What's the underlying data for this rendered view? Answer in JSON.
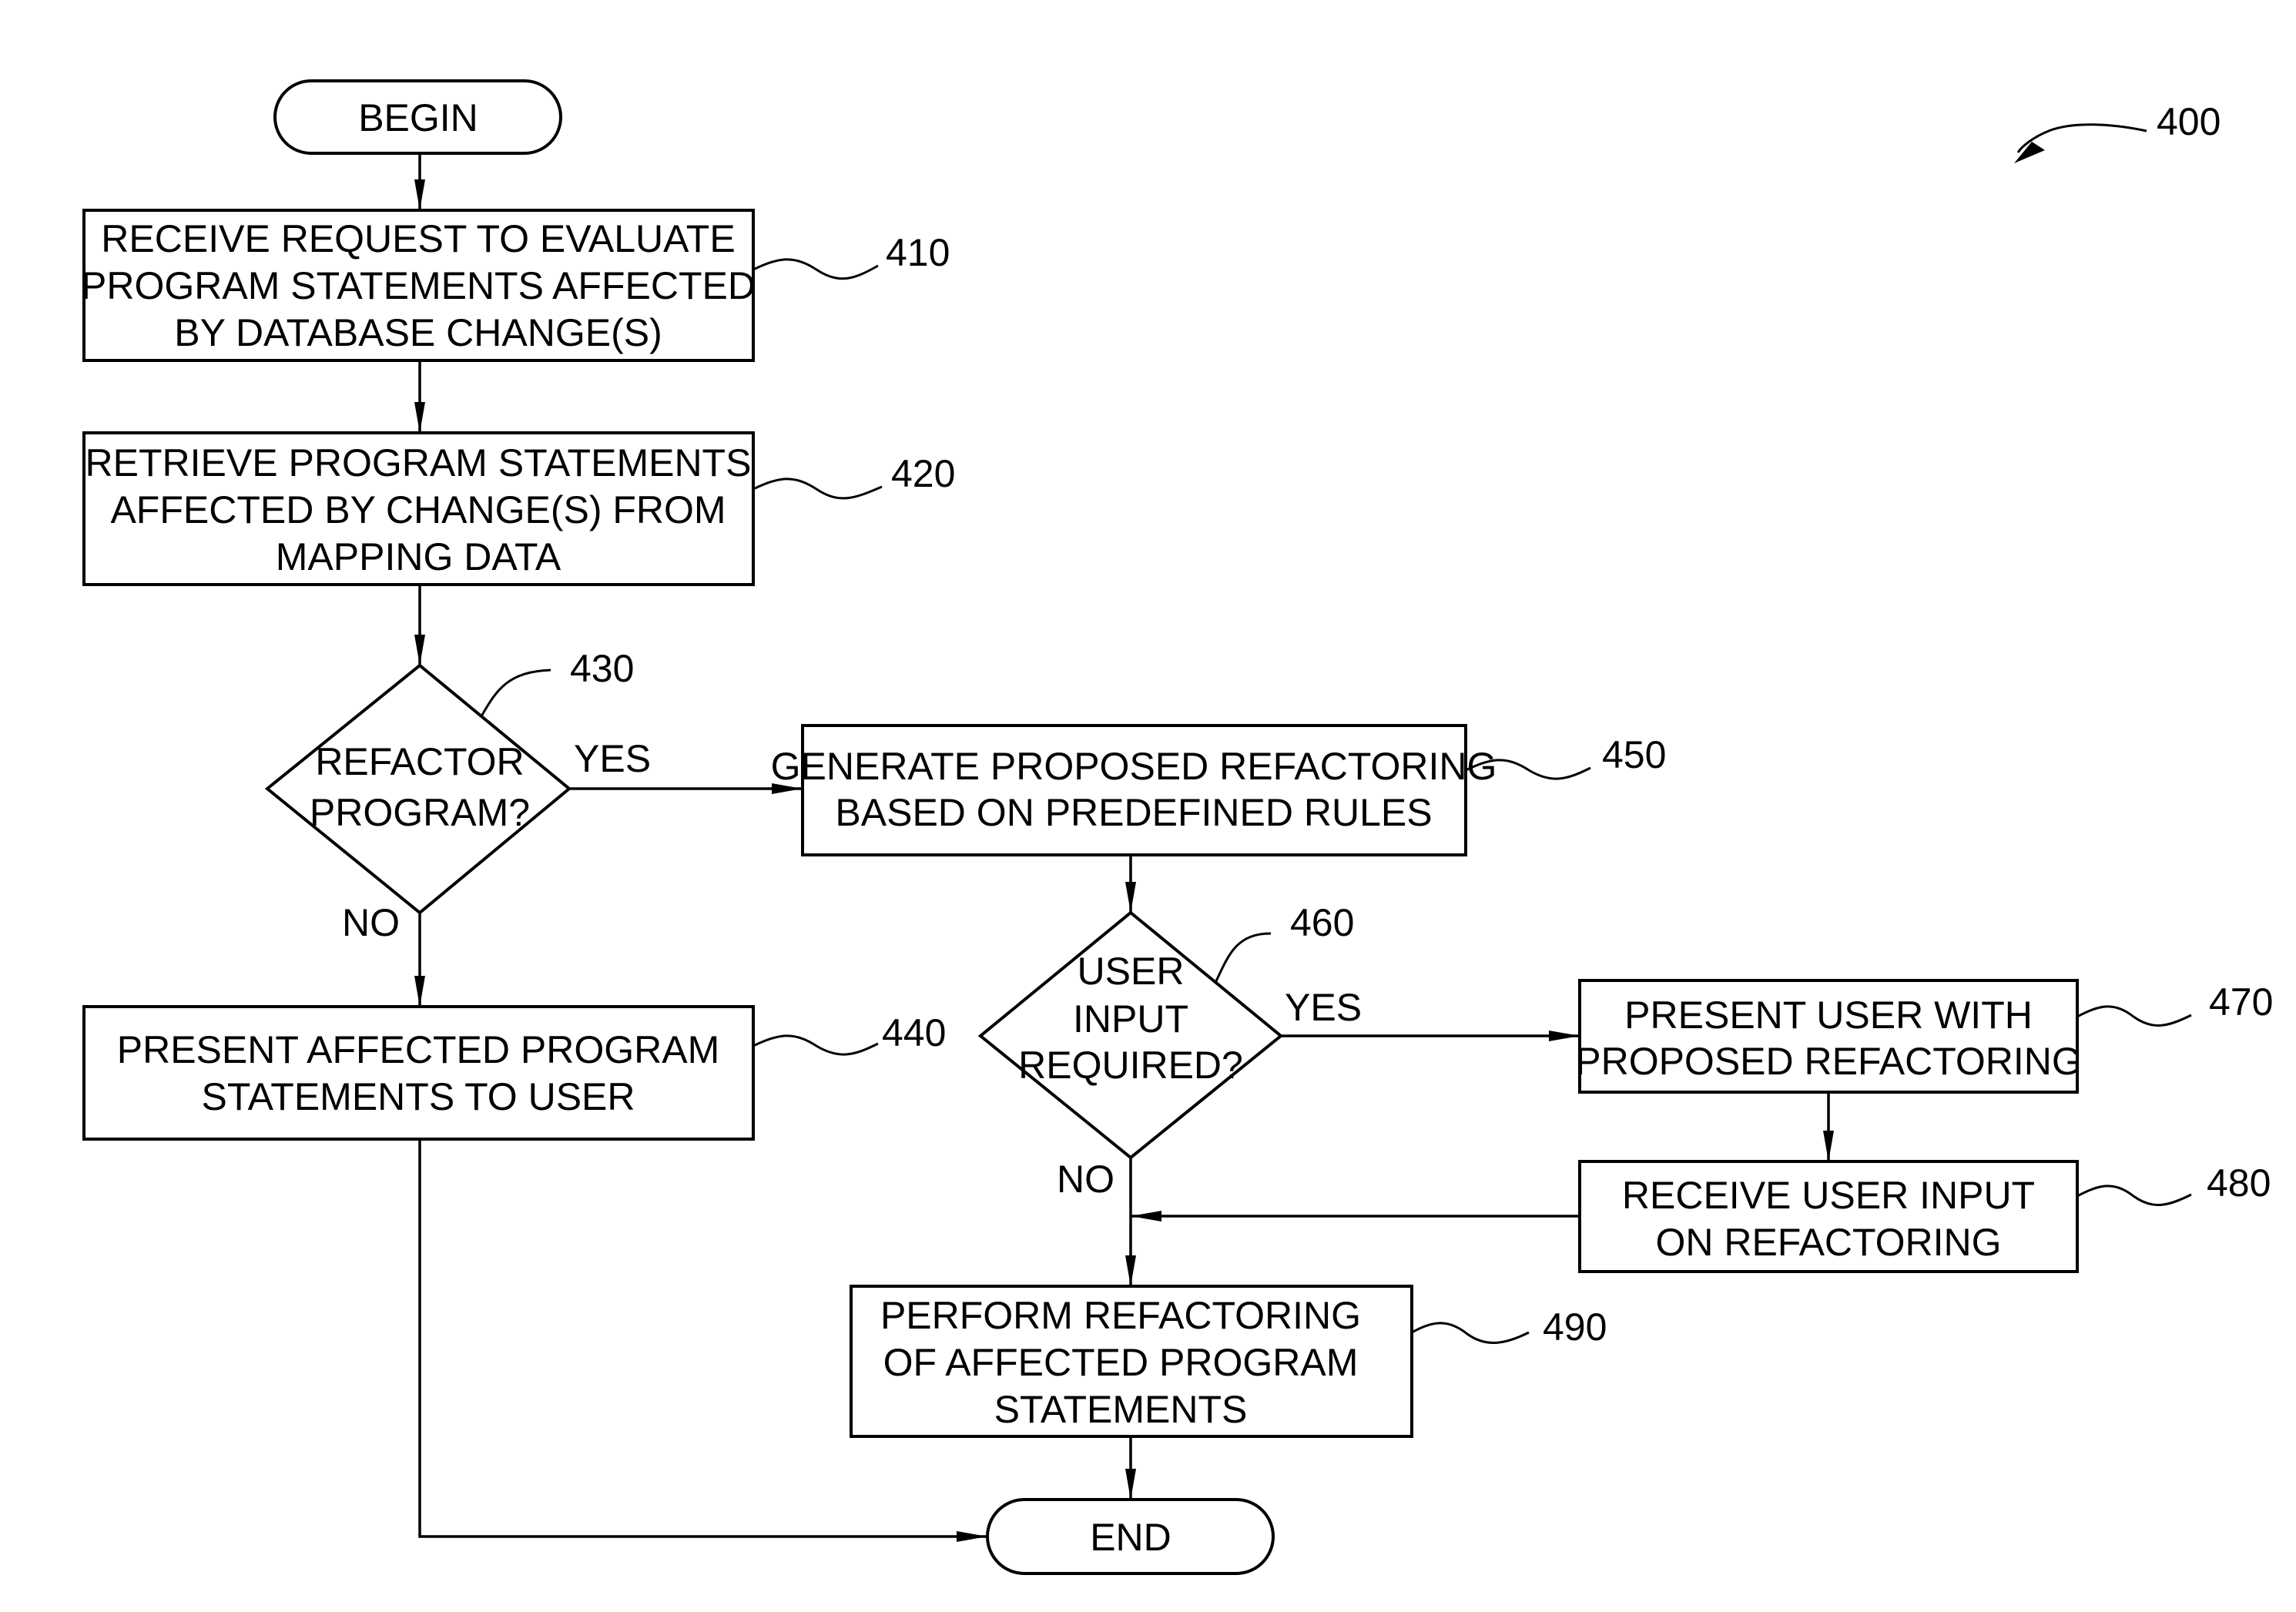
{
  "figure": {
    "reference": "400",
    "terminals": {
      "begin": "BEGIN",
      "end": "END"
    },
    "steps": [
      {
        "id": "410",
        "lines": [
          "RECEIVE REQUEST TO EVALUATE",
          "PROGRAM STATEMENTS AFFECTED",
          "BY DATABASE CHANGE(S)"
        ]
      },
      {
        "id": "420",
        "lines": [
          "RETRIEVE PROGRAM STATEMENTS",
          "AFFECTED BY CHANGE(S) FROM",
          "MAPPING DATA"
        ]
      },
      {
        "id": "430",
        "lines": [
          "REFACTOR",
          "PROGRAM?"
        ],
        "type": "decision"
      },
      {
        "id": "440",
        "lines": [
          "PRESENT AFFECTED PROGRAM",
          "STATEMENTS TO USER"
        ]
      },
      {
        "id": "450",
        "lines": [
          "GENERATE PROPOSED REFACTORING",
          "BASED ON PREDEFINED RULES"
        ]
      },
      {
        "id": "460",
        "lines": [
          "USER",
          "INPUT",
          "REQUIRED?"
        ],
        "type": "decision"
      },
      {
        "id": "470",
        "lines": [
          "PRESENT USER WITH",
          "PROPOSED REFACTORING"
        ]
      },
      {
        "id": "480",
        "lines": [
          "RECEIVE USER INPUT",
          "ON REFACTORING"
        ]
      },
      {
        "id": "490",
        "lines": [
          "PERFORM REFACTORING",
          "OF AFFECTED PROGRAM",
          "STATEMENTS"
        ]
      }
    ],
    "branch_labels": {
      "d430_yes": "YES",
      "d430_no": "NO",
      "d460_yes": "YES",
      "d460_no": "NO"
    }
  }
}
